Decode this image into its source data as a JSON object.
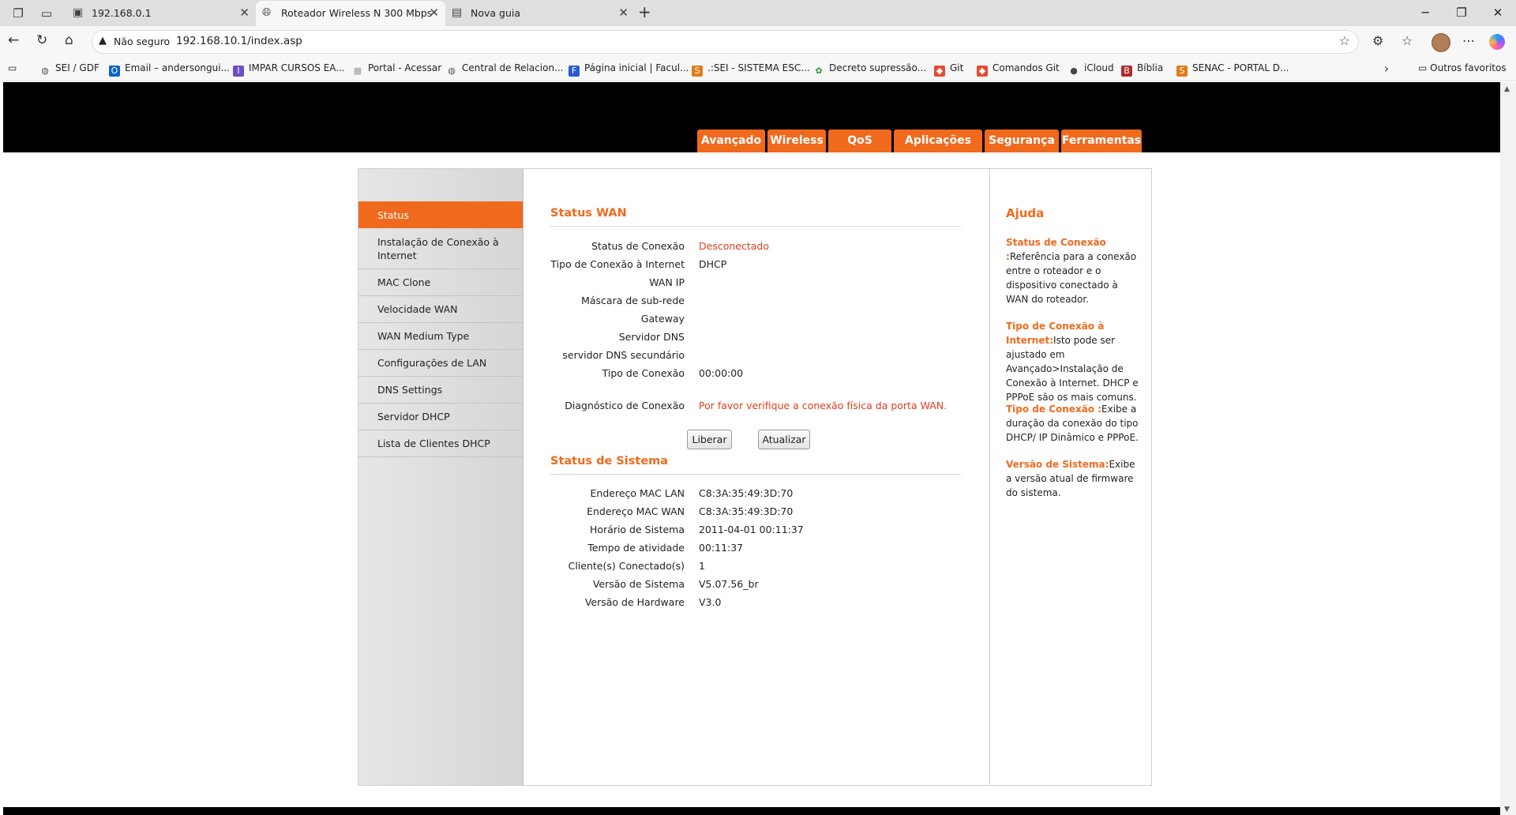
{
  "browser": {
    "tabs": [
      {
        "title": "192.168.0.1"
      },
      {
        "title": "Roteador Wireless N 300 Mbps"
      },
      {
        "title": "Nova guia"
      }
    ],
    "security_label": "Não seguro",
    "url": "192.168.10.1/index.asp",
    "bookmarks": [
      {
        "label": "SEI / GDF",
        "icon": "globe-icon",
        "color": "#555555"
      },
      {
        "label": "Email – andersongui...",
        "icon": "outlook-icon",
        "color": "#0a64c8"
      },
      {
        "label": "IMPAR CURSOS EA...",
        "icon": "impar-icon",
        "color": "#6a4fc7"
      },
      {
        "label": "Portal - Acessar",
        "icon": "image-icon",
        "color": "#999999"
      },
      {
        "label": "Central de Relacion...",
        "icon": "globe-icon",
        "color": "#555555"
      },
      {
        "label": "Página inicial | Facul...",
        "icon": "faculdade-icon",
        "color": "#2a5bd7"
      },
      {
        "label": ".:SEI - SISTEMA ESC...",
        "icon": "sei-icon",
        "color": "#e07b16"
      },
      {
        "label": "Decreto supressão...",
        "icon": "leaf-icon",
        "color": "#3a9a3a"
      },
      {
        "label": "Git",
        "icon": "git-icon",
        "color": "#e44c30"
      },
      {
        "label": "Comandos Git",
        "icon": "git-icon",
        "color": "#e44c30"
      },
      {
        "label": "iCloud",
        "icon": "apple-icon",
        "color": "#444444"
      },
      {
        "label": "Bíblia",
        "icon": "bible-icon",
        "color": "#b3282d"
      },
      {
        "label": "SENAC - PORTAL D...",
        "icon": "senac-icon",
        "color": "#e07b16"
      }
    ],
    "other_favorites": "Outros favoritos"
  },
  "router": {
    "top_nav": [
      {
        "label": "Avançado",
        "active": true
      },
      {
        "label": "Wireless",
        "active": false
      },
      {
        "label": "QoS",
        "active": false
      },
      {
        "label": "Aplicações",
        "active": false
      },
      {
        "label": "Segurança",
        "active": false
      },
      {
        "label": "Ferramentas",
        "active": false
      }
    ],
    "sidebar": [
      {
        "label": "Status",
        "active": true
      },
      {
        "label": "Instalação de Conexão à Internet",
        "active": false
      },
      {
        "label": "MAC Clone",
        "active": false
      },
      {
        "label": "Velocidade WAN",
        "active": false
      },
      {
        "label": "WAN Medium Type",
        "active": false
      },
      {
        "label": "Configurações de LAN",
        "active": false
      },
      {
        "label": "DNS Settings",
        "active": false
      },
      {
        "label": "Servidor DHCP",
        "active": false
      },
      {
        "label": "Lista de Clientes DHCP",
        "active": false
      }
    ],
    "wan_status": {
      "title": "Status WAN",
      "rows": [
        {
          "label": "Status de Conexão",
          "value": "Desconectado",
          "highlight": true
        },
        {
          "label": "Tipo de Conexão à Internet",
          "value": "DHCP",
          "highlight": false
        },
        {
          "label": "WAN IP",
          "value": "",
          "highlight": false
        },
        {
          "label": "Máscara de sub-rede",
          "value": "",
          "highlight": false
        },
        {
          "label": "Gateway",
          "value": "",
          "highlight": false
        },
        {
          "label": "Servidor DNS",
          "value": "",
          "highlight": false
        },
        {
          "label": "servidor DNS secundário",
          "value": "",
          "highlight": false
        },
        {
          "label": "Tipo de Conexão",
          "value": "00:00:00",
          "highlight": false
        }
      ],
      "diagnostic": {
        "label": "Diagnóstico de Conexão",
        "value": "Por favor verifique a conexão física da porta WAN."
      },
      "buttons": {
        "release": "Liberar",
        "refresh": "Atualizar"
      }
    },
    "system_status": {
      "title": "Status de Sistema",
      "rows": [
        {
          "label": "Endereço MAC LAN",
          "value": "C8:3A:35:49:3D:70"
        },
        {
          "label": "Endereço MAC WAN",
          "value": "C8:3A:35:49:3D:70"
        },
        {
          "label": "Horário de Sistema",
          "value": "2011-04-01 00:11:37"
        },
        {
          "label": "Tempo de atividade",
          "value": "00:11:37"
        },
        {
          "label": "Cliente(s) Conectado(s)",
          "value": "1"
        },
        {
          "label": "Versão de Sistema",
          "value": "V5.07.56_br"
        },
        {
          "label": "Versão de Hardware",
          "value": "V3.0"
        }
      ]
    },
    "help": {
      "title": "Ajuda",
      "items": [
        {
          "key": "Status de Conexão :",
          "text": "Referência para a conexão entre o roteador e o dispositivo conectado à WAN do roteador."
        },
        {
          "key": "Tipo de Conexão à Internet:",
          "text": "Isto pode ser ajustado em Avançado>Instalação de Conexão à Internet. DHCP e PPPoE são os mais comuns."
        },
        {
          "key": "Tipo de Conexão :",
          "text": "Exibe a duração da conexão do tipo DHCP/ IP Dinâmico e PPPoE."
        },
        {
          "key": "Versão de Sistema:",
          "text": "Exibe a versão atual de firmware do sistema."
        }
      ]
    },
    "accent_color": "#f06a1e"
  }
}
